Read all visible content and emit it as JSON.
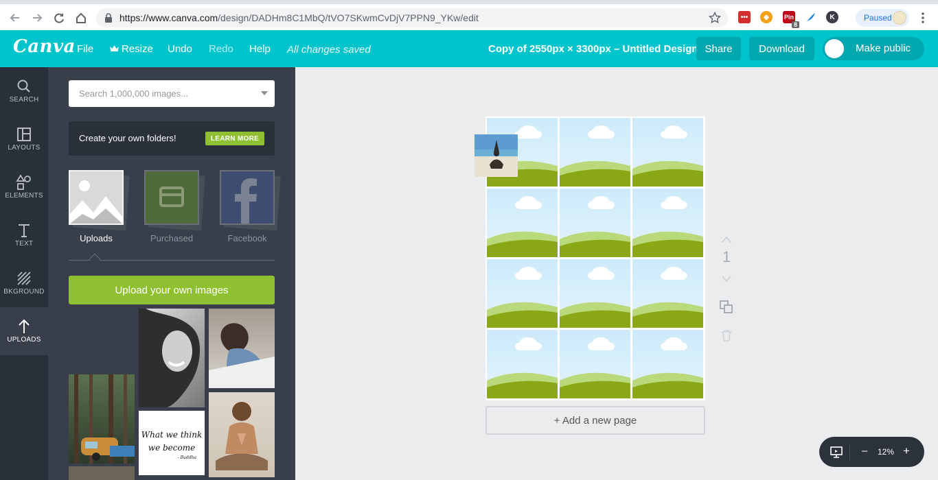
{
  "browser": {
    "url_host": "https://www.canva.com",
    "url_path": "/design/DADHm8C1MbQ/tVO7SKwmCvDjV7PPN9_YKw/edit",
    "profile_status": "Paused",
    "ext_badge_count": "8",
    "ext_pin_label": "Pin",
    "ext_k_label": "K"
  },
  "header": {
    "logo": "Canva",
    "menu": [
      "File",
      "Resize",
      "Undo",
      "Redo",
      "Help"
    ],
    "save_status": "All changes saved",
    "design_title": "Copy of 2550px × 3300px – Untitled Design",
    "share_label": "Share",
    "download_label": "Download",
    "make_public_label": "Make public"
  },
  "rail": {
    "items": [
      "SEARCH",
      "LAYOUTS",
      "ELEMENTS",
      "TEXT",
      "BKGROUND",
      "UPLOADS"
    ],
    "active": "UPLOADS"
  },
  "panel": {
    "search_placeholder": "Search 1,000,000 images...",
    "promo_text": "Create your own folders!",
    "promo_button": "LEARN MORE",
    "tabs": [
      "Uploads",
      "Purchased",
      "Facebook"
    ],
    "active_tab": "Uploads",
    "upload_button": "Upload your own images",
    "quote_line1": "What we think",
    "quote_line2": "we become",
    "quote_author": "- Buddha"
  },
  "canvas": {
    "grid_rows": 4,
    "grid_cols": 3,
    "add_page_label": "+ Add a new page",
    "page_number": "1",
    "zoom_minus": "–",
    "zoom_level": "12%",
    "zoom_plus": "+"
  },
  "colors": {
    "brand_teal": "#00c4cc",
    "button_teal": "#00a7ae",
    "accent_green": "#8fc031",
    "rail_bg": "#293039",
    "panel_bg": "#383f4a"
  }
}
